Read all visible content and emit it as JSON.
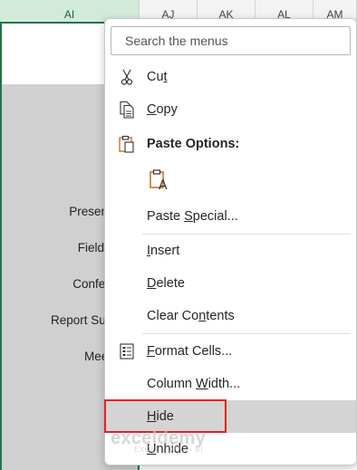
{
  "sheet": {
    "columns": [
      {
        "label": "AI",
        "selected": true
      },
      {
        "label": "AJ",
        "selected": false
      },
      {
        "label": "AK",
        "selected": false
      },
      {
        "label": "AL",
        "selected": false
      },
      {
        "label": "AM",
        "selected": false
      }
    ],
    "cells": [
      "Presentation",
      "Field Visit",
      "Conference",
      "Report Submiss",
      "Meeting"
    ],
    "accent_color": "#217346"
  },
  "menu": {
    "search_placeholder": "Search the menus",
    "cut": {
      "pre": "Cu",
      "acc": "t",
      "post": ""
    },
    "copy": {
      "pre": "",
      "acc": "C",
      "post": "opy"
    },
    "paste_options": "Paste Options:",
    "paste_special": {
      "pre": "Paste ",
      "acc": "S",
      "post": "pecial..."
    },
    "insert": {
      "pre": "",
      "acc": "I",
      "post": "nsert"
    },
    "delete": {
      "pre": "",
      "acc": "D",
      "post": "elete"
    },
    "clear_contents": {
      "pre": "Clear Co",
      "acc": "n",
      "post": "tents"
    },
    "format_cells": {
      "pre": "",
      "acc": "F",
      "post": "ormat Cells..."
    },
    "column_width": {
      "pre": "Column ",
      "acc": "W",
      "post": "idth..."
    },
    "hide": {
      "pre": "",
      "acc": "H",
      "post": "ide"
    },
    "unhide": {
      "pre": "",
      "acc": "U",
      "post": "nhide"
    },
    "highlight_color": "#e02424"
  },
  "watermark": {
    "brand": "exceldemy",
    "tagline": "EXCEL · DATA · BI"
  }
}
